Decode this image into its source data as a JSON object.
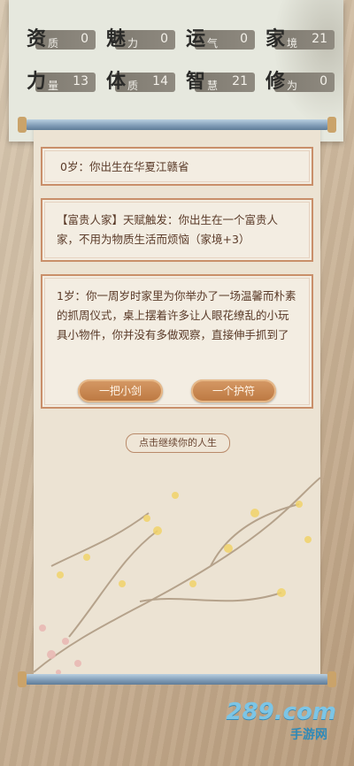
{
  "stats": [
    {
      "big": "资",
      "small": "质",
      "value": "0"
    },
    {
      "big": "魅",
      "small": "力",
      "value": "0"
    },
    {
      "big": "运",
      "small": "气",
      "value": "0"
    },
    {
      "big": "家",
      "small": "境",
      "value": "21"
    },
    {
      "big": "力",
      "small": "量",
      "value": "13"
    },
    {
      "big": "体",
      "small": "质",
      "value": "14"
    },
    {
      "big": "智",
      "small": "慧",
      "value": "21"
    },
    {
      "big": "修",
      "small": "为",
      "value": "0"
    }
  ],
  "events": [
    {
      "text": "0岁：你出生在华夏江赣省"
    },
    {
      "text": "【富贵人家】天赋触发：你出生在一个富贵人家，不用为物质生活而烦恼（家境+3）"
    },
    {
      "text": "1岁：你一周岁时家里为你举办了一场温馨而朴素的抓周仪式，桌上摆着许多让人眼花缭乱的小玩具小物件，你并没有多做观察，直接伸手抓到了"
    }
  ],
  "choices": [
    "一把小剑",
    "一个护符"
  ],
  "continue_label": "点击继续你的人生",
  "watermark": {
    "main": "289.com",
    "sub": "手游网"
  },
  "colors": {
    "card_border": "#c98f6a",
    "button": "#bb7740",
    "rod": "#7e9ab5"
  }
}
